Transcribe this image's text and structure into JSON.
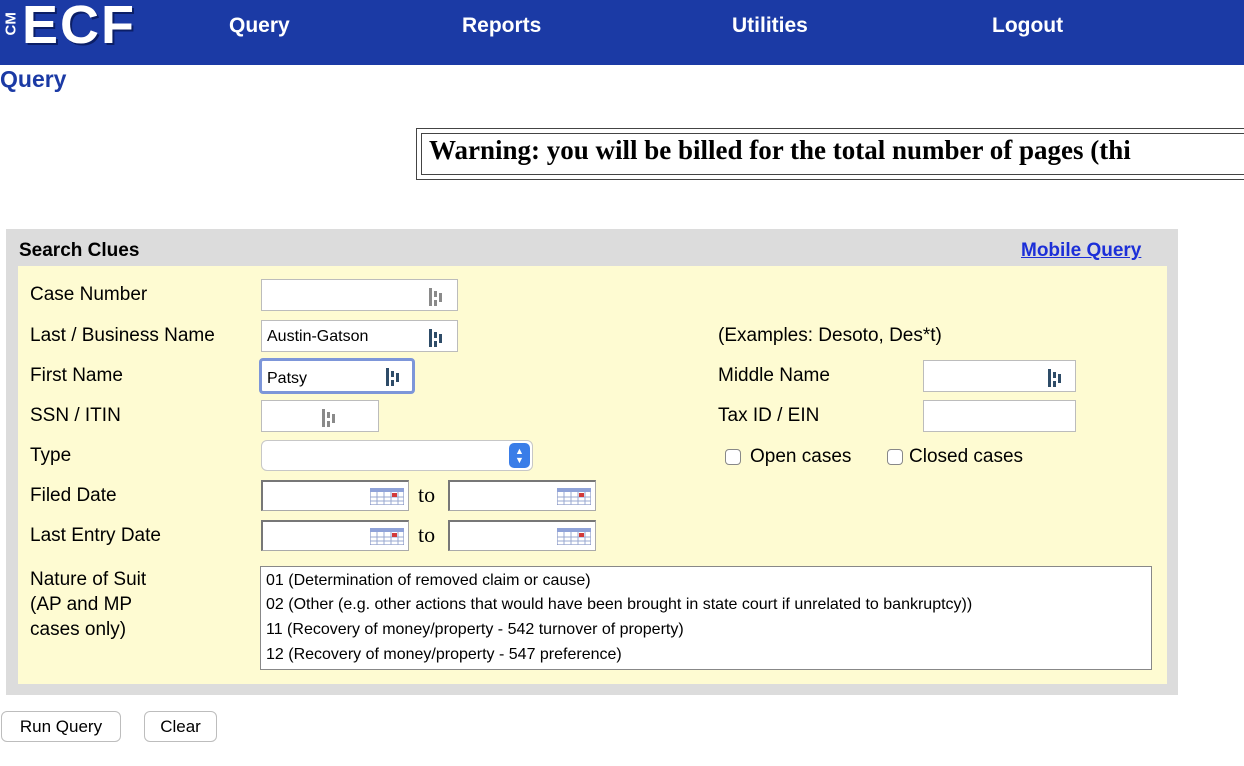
{
  "header": {
    "logo_cm": "CM",
    "logo_ecf": "ECF",
    "nav": [
      "Query",
      "Reports",
      "Utilities",
      "Logout"
    ],
    "background": "#1b3aa5"
  },
  "page_title": "Query",
  "warning": "Warning: you will be billed for the total number of pages (thi",
  "panel": {
    "title": "Search Clues",
    "mobile_link": "Mobile Query"
  },
  "form": {
    "case_number": {
      "label": "Case Number",
      "value": ""
    },
    "last_name": {
      "label": "Last / Business Name",
      "value": "Austin-Gatson"
    },
    "first_name": {
      "label": "First Name",
      "value": "Patsy"
    },
    "ssn": {
      "label": "SSN / ITIN",
      "value": ""
    },
    "type": {
      "label": "Type",
      "value": ""
    },
    "filed_date": {
      "label": "Filed Date",
      "to": "to"
    },
    "last_entry_date": {
      "label": "Last Entry Date",
      "to": "to"
    },
    "examples": "(Examples: Desoto, Des*t)",
    "middle_name": {
      "label": "Middle Name",
      "value": ""
    },
    "tax_id": {
      "label": "Tax ID / EIN",
      "value": ""
    },
    "open_cases": "Open cases",
    "closed_cases": "Closed cases",
    "nature_of_suit": {
      "label_lines": [
        "Nature of Suit",
        "(AP and MP",
        "cases only)"
      ],
      "options": [
        "01 (Determination of removed claim or cause)",
        "02 (Other (e.g. other actions that would have been brought in state court if unrelated to bankruptcy))",
        "11 (Recovery of money/property - 542 turnover of property)",
        "12 (Recovery of money/property - 547 preference)"
      ]
    }
  },
  "buttons": {
    "run": "Run Query",
    "clear": "Clear"
  },
  "colors": {
    "panel_bg": "#fefbd2",
    "link": "#1c2fd8"
  }
}
